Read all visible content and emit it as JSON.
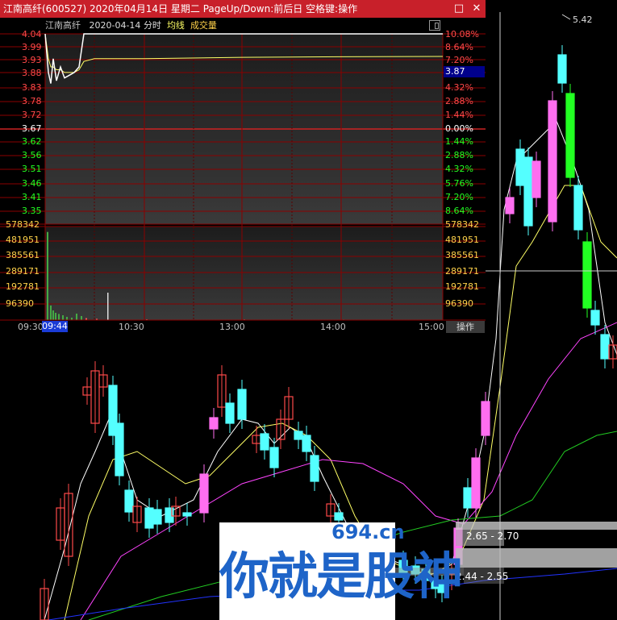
{
  "window": {
    "title": "江南高纤(600527) 2020年04月14日 星期二 PageUp/Down:前后日 空格键:操作",
    "minimize_glyph": "□",
    "close_glyph": "✕"
  },
  "info": {
    "name": "江南高纤",
    "date": "2020-04-14",
    "mode": "分时",
    "avg_line": "均线",
    "volume": "成交量"
  },
  "price_axis_left": [
    "4.04",
    "3.99",
    "3.93",
    "3.88",
    "3.83",
    "3.78",
    "3.72",
    "3.67",
    "3.62",
    "3.56",
    "3.51",
    "3.46",
    "3.41",
    "3.35"
  ],
  "pct_axis_right": [
    "10.08%",
    "8.64%",
    "7.20%",
    "4.32%",
    "2.88%",
    "1.44%",
    "0.00%",
    "1.44%",
    "2.88%",
    "4.32%",
    "5.76%",
    "7.20%",
    "8.64%"
  ],
  "current_price": "3.87",
  "volume_axis": [
    "578342",
    "481951",
    "385561",
    "289171",
    "192781",
    "96390"
  ],
  "time_axis": [
    "09:30",
    "10:30",
    "13:00",
    "14:00",
    "15:00"
  ],
  "cursor_time": "09:44",
  "ops_button": "操作",
  "chart_high_label": "5.42",
  "ranges": [
    "2.65 - 2.70",
    "2.44 - 2.55"
  ],
  "watermark": {
    "site": "694.cn",
    "slogan": "你就是股神"
  },
  "colors": {
    "up": "#ff4a4a",
    "up_fill": "#ff6ef0",
    "down": "#54ffff",
    "down_strong": "#22ff22",
    "grid": "#8b0000",
    "titlebar": "#c8202a",
    "price_line": "#ffffff",
    "avg_line_color": "#ffff66",
    "volume_bar": "#44aa44"
  },
  "chart_data": {
    "type": "line",
    "title": "",
    "x": [
      "09:30",
      "09:32",
      "09:34",
      "09:36",
      "09:38",
      "09:40",
      "09:42",
      "09:44",
      "09:46",
      "09:50",
      "10:00",
      "10:30",
      "11:30",
      "13:00",
      "14:00",
      "15:00"
    ],
    "series": [
      {
        "name": "",
        "values": [
          4.04,
          3.9,
          3.86,
          3.95,
          3.87,
          3.92,
          3.88,
          3.89,
          3.9,
          3.92,
          4.04,
          4.04,
          4.04,
          4.04,
          4.04,
          4.04
        ]
      },
      {
        "name": "均线",
        "values": [
          4.04,
          3.95,
          3.92,
          3.92,
          3.91,
          3.91,
          3.9,
          3.9,
          3.9,
          3.91,
          3.94,
          3.95,
          3.95,
          3.955,
          3.957,
          3.958
        ]
      }
    ],
    "volume": [
      545000,
      90000,
      60000,
      45000,
      38000,
      30000,
      20000,
      15000,
      40000,
      25000,
      12000,
      8000,
      5000,
      4000,
      3000,
      2000
    ],
    "xlabel": "",
    "ylabel": "",
    "ylim": [
      3.35,
      4.04
    ]
  }
}
